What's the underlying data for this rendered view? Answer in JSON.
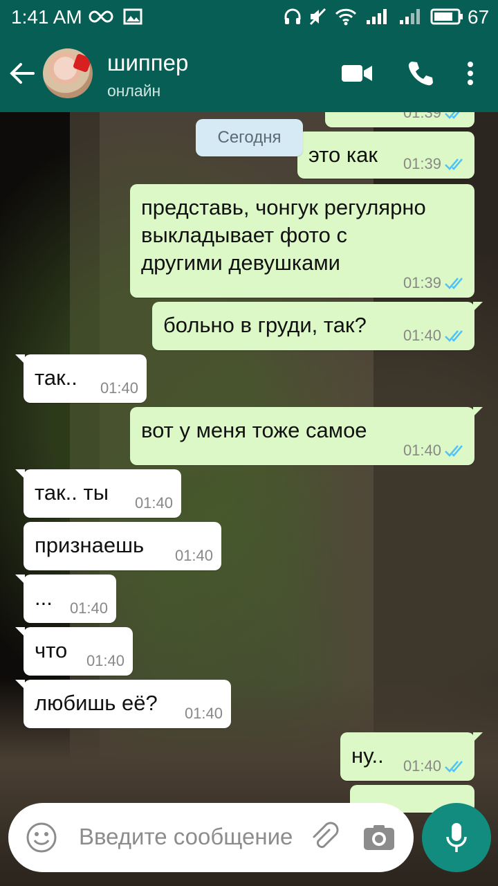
{
  "status_bar": {
    "time": "1:41 AM",
    "battery": "67"
  },
  "header": {
    "contact_name": "шиппер",
    "contact_status": "онлайн"
  },
  "date_chip": "Сегодня",
  "messages": [
    {
      "dir": "out",
      "text": "",
      "time": "01:39"
    },
    {
      "dir": "out",
      "text": "это как",
      "time": "01:39"
    },
    {
      "dir": "out",
      "text": "представь, чонгук регулярно\nвыкладывает фото с\nдругими девушками",
      "time": "01:39"
    },
    {
      "dir": "out",
      "text": "больно в груди, так?",
      "time": "01:40"
    },
    {
      "dir": "in",
      "text": "так..",
      "time": "01:40"
    },
    {
      "dir": "out",
      "text": "вот у меня тоже самое",
      "time": "01:40"
    },
    {
      "dir": "in",
      "text": "так.. ты",
      "time": "01:40"
    },
    {
      "dir": "in",
      "text": "признаешь",
      "time": "01:40"
    },
    {
      "dir": "in",
      "text": "...",
      "time": "01:40"
    },
    {
      "dir": "in",
      "text": "что",
      "time": "01:40"
    },
    {
      "dir": "in",
      "text": "любишь её?",
      "time": "01:40"
    },
    {
      "dir": "out",
      "text": "ну..",
      "time": "01:40"
    }
  ],
  "input": {
    "placeholder": "Введите сообщение"
  },
  "colors": {
    "header": "#075e54",
    "outgoing": "#dcf8c6",
    "incoming": "#ffffff",
    "mic": "#128c7e",
    "tick": "#4fc3f7"
  }
}
